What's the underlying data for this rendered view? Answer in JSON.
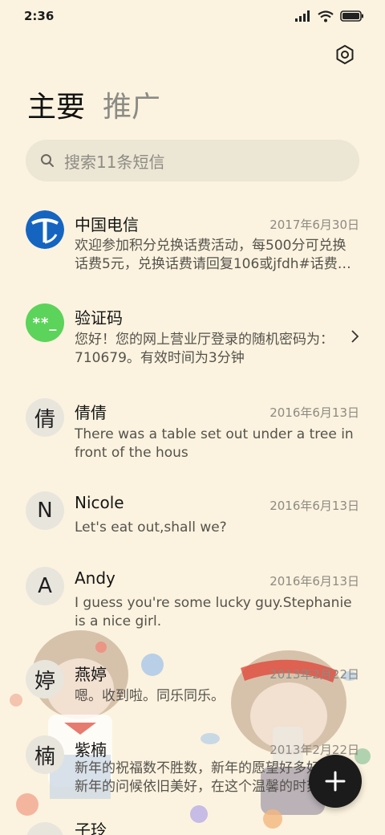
{
  "status_bar": {
    "time": "2:36"
  },
  "tabs": {
    "main": "主要",
    "promo": "推广"
  },
  "search": {
    "placeholder": "搜索11条短信"
  },
  "colors": {
    "background": "#fbf3df",
    "green_avatar": "#5cd35a",
    "telecom_blue": "#1565c0",
    "fab": "#1b1b1b"
  },
  "messages": [
    {
      "avatar": "telecom-logo",
      "name": "中国电信",
      "date": "2017年6月30日",
      "preview": "欢迎参加积分兑换话费活动，每500分可兑换话费5元，兑换话费请回复106或jfdh#话费…"
    },
    {
      "avatar": "**_",
      "name": "验证码",
      "date": "",
      "preview": "您好！您的网上营业厅登录的随机密码为：710679。有效时间为3分钟"
    },
    {
      "avatar": "倩",
      "name": "倩倩",
      "date": "2016年6月13日",
      "preview": "There was a table set out under a tree in front of the hous"
    },
    {
      "avatar": "N",
      "name": "Nicole",
      "date": "2016年6月13日",
      "preview": "Let's eat out,shall we?"
    },
    {
      "avatar": "A",
      "name": "Andy",
      "date": "2016年6月13日",
      "preview": "I guess you're some lucky guy.Stephanie is a nice girl."
    },
    {
      "avatar": "婷",
      "name": "燕婷",
      "date": "2013年2月22日",
      "preview": "嗯。收到啦。同乐同乐。"
    },
    {
      "avatar": "楠",
      "name": "紫楠",
      "date": "2013年2月22日",
      "preview": "新年的祝福数不胜数，新年的愿望好多好多，新年的问候依旧美好，在这个温馨的时刻"
    },
    {
      "avatar": "",
      "name": "子玲",
      "date": "",
      "preview": ""
    }
  ]
}
